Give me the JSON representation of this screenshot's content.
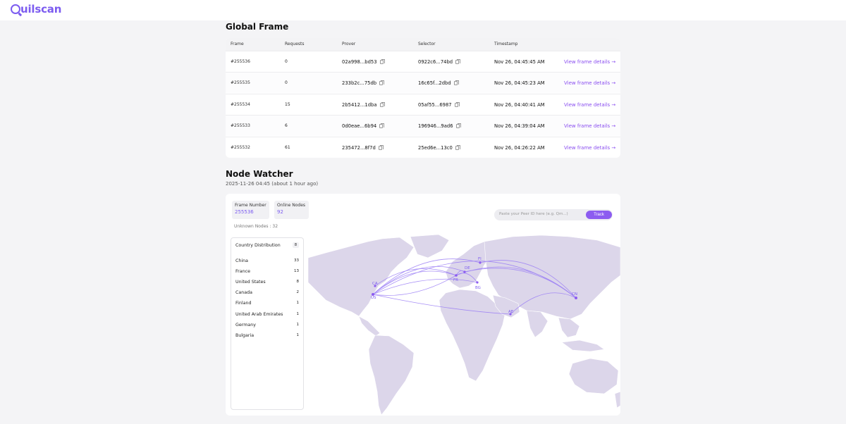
{
  "header": {
    "logo_text": "uilscan",
    "brand_color": "#7c5cf0"
  },
  "global_frame": {
    "title": "Global Frame",
    "columns": [
      "Frame",
      "Requests",
      "Prover",
      "Selector",
      "Timestamp"
    ],
    "rows": [
      {
        "frame": "#255536",
        "requests": "0",
        "prover": "02a998...bd53",
        "selector": "0922c6...74bd",
        "timestamp": "Nov 26, 04:45:45 AM",
        "link": "View frame details →"
      },
      {
        "frame": "#255535",
        "requests": "0",
        "prover": "233b2c...75db",
        "selector": "16c65f...2dbd",
        "timestamp": "Nov 26, 04:45:23 AM",
        "link": "View frame details →"
      },
      {
        "frame": "#255534",
        "requests": "15",
        "prover": "2b5412...1dba",
        "selector": "05af55...6987",
        "timestamp": "Nov 26, 04:40:41 AM",
        "link": "View frame details →"
      },
      {
        "frame": "#255533",
        "requests": "6",
        "prover": "0d0eae...6b94",
        "selector": "196946...9ad6",
        "timestamp": "Nov 26, 04:39:04 AM",
        "link": "View frame details →"
      },
      {
        "frame": "#255532",
        "requests": "61",
        "prover": "235472...8f7d",
        "selector": "25ed6e...13c0",
        "timestamp": "Nov 26, 04:26:22 AM",
        "link": "View frame details →"
      }
    ]
  },
  "node_watcher": {
    "title": "Node Watcher",
    "date": "2025-11-26 04:45 (about 1 hour ago)",
    "frame_number_label": "Frame Number",
    "frame_number": "255536",
    "online_nodes_label": "Online Nodes",
    "online_nodes": "92",
    "unknown_nodes": "Unknown Nodes : 32",
    "track_placeholder": "Paste your Peer ID here (e.g. Qm...)",
    "track_button": "Track",
    "distribution_title": "Country Distribution",
    "distribution_count": "8",
    "countries": [
      {
        "name": "China",
        "count": "33"
      },
      {
        "name": "France",
        "count": "13"
      },
      {
        "name": "United States",
        "count": "8"
      },
      {
        "name": "Canada",
        "count": "2"
      },
      {
        "name": "Finland",
        "count": "1"
      },
      {
        "name": "United Arab Emirates",
        "count": "1"
      },
      {
        "name": "Germany",
        "count": "1"
      },
      {
        "name": "Bulgaria",
        "count": "1"
      }
    ],
    "map_labels": [
      "CA",
      "US",
      "FR",
      "DE",
      "FI",
      "BG",
      "AE",
      "CN"
    ]
  }
}
